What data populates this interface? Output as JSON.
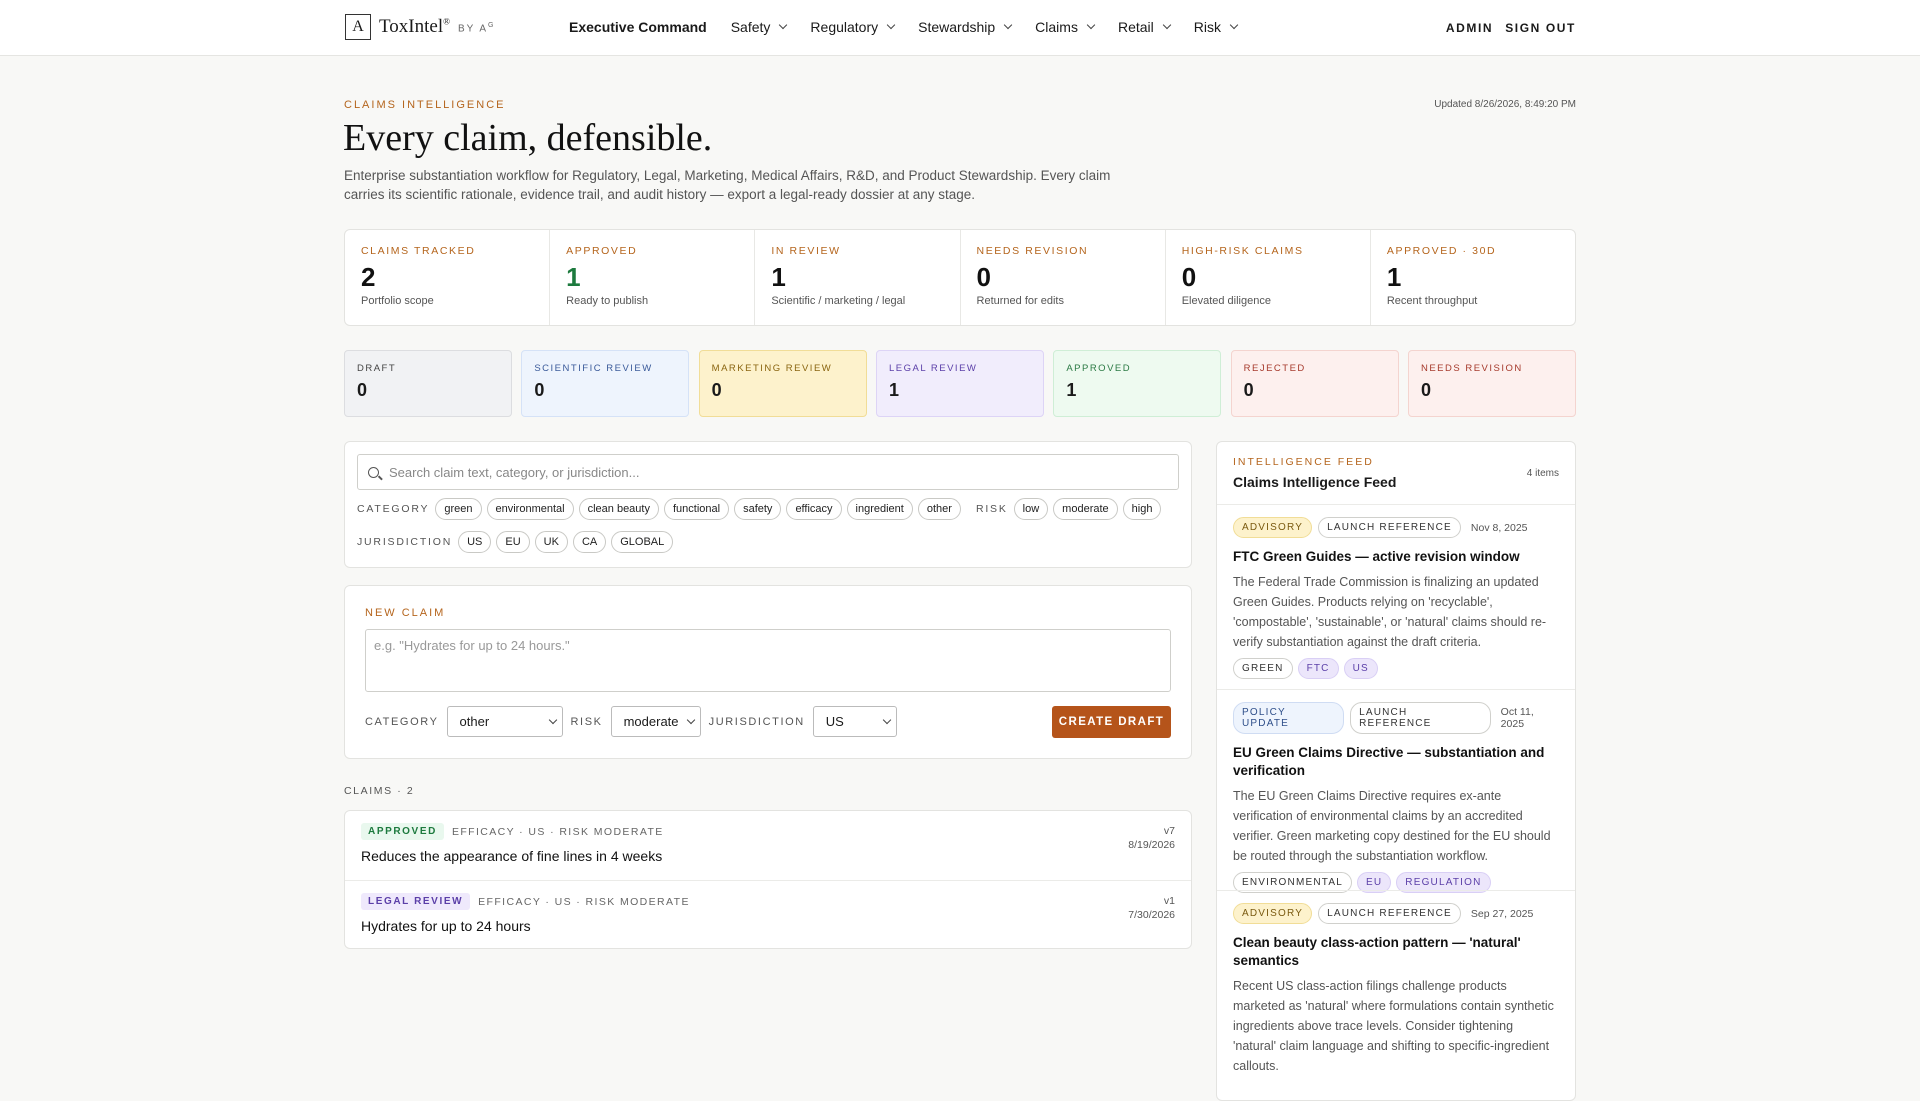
{
  "brand": {
    "mark": "A",
    "name": "ToxIntel",
    "reg": "®",
    "by": "BY A",
    "by_sup": "G"
  },
  "nav": [
    "Executive Command",
    "Safety",
    "Regulatory",
    "Stewardship",
    "Claims",
    "Retail",
    "Risk"
  ],
  "top_actions": {
    "admin": "ADMIN",
    "signout": "SIGN OUT"
  },
  "hero": {
    "eyebrow": "CLAIMS INTELLIGENCE",
    "updated": "Updated 8/26/2026, 8:49:20 PM",
    "title": "Every claim, defensible.",
    "desc": "Enterprise substantiation workflow for Regulatory, Legal, Marketing, Medical Affairs, R&D, and Product Stewardship. Every claim carries its scientific rationale, evidence trail, and audit history — export a legal-ready dossier at any stage."
  },
  "stats": [
    {
      "label": "CLAIMS TRACKED",
      "value": "2",
      "sub": "Portfolio scope",
      "color": "#111111"
    },
    {
      "label": "APPROVED",
      "value": "1",
      "sub": "Ready to publish",
      "color": "#1d7a3e"
    },
    {
      "label": "IN REVIEW",
      "value": "1",
      "sub": "Scientific / marketing / legal",
      "color": "#111111"
    },
    {
      "label": "NEEDS REVISION",
      "value": "0",
      "sub": "Returned for edits",
      "color": "#111111"
    },
    {
      "label": "HIGH-RISK CLAIMS",
      "value": "0",
      "sub": "Elevated diligence",
      "color": "#111111"
    },
    {
      "label": "APPROVED · 30D",
      "value": "1",
      "sub": "Recent throughput",
      "color": "#111111"
    }
  ],
  "pipeline": [
    {
      "label": "DRAFT",
      "value": "0",
      "bg": "#f1f2f4",
      "border": "#dcdde0",
      "fg": "#444444"
    },
    {
      "label": "SCIENTIFIC REVIEW",
      "value": "0",
      "bg": "#eef4fd",
      "border": "#d5e2f7",
      "fg": "#3a5a9a"
    },
    {
      "label": "MARKETING REVIEW",
      "value": "0",
      "bg": "#fdf2cc",
      "border": "#f1dd97",
      "fg": "#8a6510"
    },
    {
      "label": "LEGAL REVIEW",
      "value": "1",
      "bg": "#f1edfc",
      "border": "#ddd4f6",
      "fg": "#5b3fa8"
    },
    {
      "label": "APPROVED",
      "value": "1",
      "bg": "#eefaf0",
      "border": "#cfeed6",
      "fg": "#2b7a44"
    },
    {
      "label": "REJECTED",
      "value": "0",
      "bg": "#fdf0ee",
      "border": "#f4d4cf",
      "fg": "#a63a2c"
    },
    {
      "label": "NEEDS REVISION",
      "value": "0",
      "bg": "#fdf0ee",
      "border": "#f4d4cf",
      "fg": "#a63a2c"
    }
  ],
  "filters": {
    "search_placeholder": "Search claim text, category, or jurisdiction...",
    "category_label": "CATEGORY",
    "categories": [
      "green",
      "environmental",
      "clean beauty",
      "functional",
      "safety",
      "efficacy",
      "ingredient",
      "other"
    ],
    "risk_label": "RISK",
    "risks": [
      "low",
      "moderate",
      "high"
    ],
    "jurisdiction_label": "JURISDICTION",
    "jurisdictions": [
      "US",
      "EU",
      "UK",
      "CA",
      "GLOBAL"
    ]
  },
  "new_claim": {
    "label": "NEW CLAIM",
    "placeholder": "e.g. \"Hydrates for up to 24 hours.\"",
    "category_label": "CATEGORY",
    "category_value": "other",
    "risk_label": "RISK",
    "risk_value": "moderate",
    "jurisdiction_label": "JURISDICTION",
    "jurisdiction_value": "US",
    "button": "CREATE DRAFT"
  },
  "claims": {
    "count_label": "CLAIMS · 2",
    "items": [
      {
        "status": "APPROVED",
        "status_bg": "#e9f8ee",
        "status_fg": "#1d7a3e",
        "meta": "EFFICACY · US · RISK MODERATE",
        "text": "Reduces the appearance of fine lines in 4 weeks",
        "version": "v7",
        "date": "8/19/2026"
      },
      {
        "status": "LEGAL REVIEW",
        "status_bg": "#efe9fc",
        "status_fg": "#5b3fa8",
        "meta": "EFFICACY · US · RISK MODERATE",
        "text": "Hydrates for up to 24 hours",
        "version": "v1",
        "date": "7/30/2026"
      }
    ]
  },
  "feed": {
    "eyebrow": "INTELLIGENCE FEED",
    "title": "Claims Intelligence Feed",
    "count": "4 items",
    "items": [
      {
        "type": "ADVISORY",
        "type_bg": "#fdf2cc",
        "type_border": "#f1dd97",
        "type_fg": "#7a5a10",
        "ref": "LAUNCH REFERENCE",
        "date": "Nov 8, 2025",
        "title": "FTC Green Guides — active revision window",
        "body": "The Federal Trade Commission is finalizing an updated Green Guides. Products relying on 'recyclable', 'compostable', 'sustainable', or 'natural' claims should re-verify substantiation against the draft criteria.",
        "chips": [
          {
            "t": "GREEN",
            "k": "neutral"
          },
          {
            "t": "FTC",
            "k": "purple"
          },
          {
            "t": "US",
            "k": "purple"
          }
        ]
      },
      {
        "type": "POLICY UPDATE",
        "type_bg": "#eef4fd",
        "type_border": "#cfdcf3",
        "type_fg": "#2f4f8a",
        "ref": "LAUNCH REFERENCE",
        "date": "Oct 11, 2025",
        "title": "EU Green Claims Directive — substantiation and verification",
        "body": "The EU Green Claims Directive requires ex-ante verification of environmental claims by an accredited verifier. Green marketing copy destined for the EU should be routed through the substantiation workflow.",
        "chips": [
          {
            "t": "ENVIRONMENTAL",
            "k": "neutral"
          },
          {
            "t": "EU",
            "k": "purple"
          },
          {
            "t": "REGULATION",
            "k": "purple"
          }
        ]
      },
      {
        "type": "ADVISORY",
        "type_bg": "#fdf2cc",
        "type_border": "#f1dd97",
        "type_fg": "#7a5a10",
        "ref": "LAUNCH REFERENCE",
        "date": "Sep 27, 2025",
        "title": "Clean beauty class-action pattern — 'natural' semantics",
        "body": "Recent US class-action filings challenge products marketed as 'natural' where formulations contain synthetic ingredients above trace levels. Consider tightening 'natural' claim language and shifting to specific-ingredient callouts.",
        "chips": []
      }
    ]
  }
}
